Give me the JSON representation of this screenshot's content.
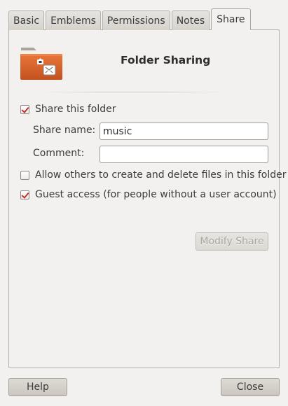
{
  "tabs": [
    {
      "label": "Basic"
    },
    {
      "label": "Emblems"
    },
    {
      "label": "Permissions"
    },
    {
      "label": "Notes"
    },
    {
      "label": "Share",
      "active": true
    }
  ],
  "header": {
    "title": "Folder Sharing",
    "icon": "folder-share-icon"
  },
  "share_folder": {
    "label": "Share this folder",
    "checked": true
  },
  "share_name": {
    "label": "Share name:",
    "value": "music"
  },
  "comment": {
    "label": "Comment:",
    "value": ""
  },
  "allow_others": {
    "label": "Allow others to create and delete files in this folder",
    "checked": false
  },
  "guest_access": {
    "label": "Guest access (for people without a user account)",
    "checked": true
  },
  "modify_button": {
    "label": "Modify Share",
    "enabled": false
  },
  "footer": {
    "help_label": "Help",
    "close_label": "Close"
  },
  "colors": {
    "accent": "#c2352c",
    "folder": "#d96a2e",
    "background": "#f2f1f0"
  }
}
